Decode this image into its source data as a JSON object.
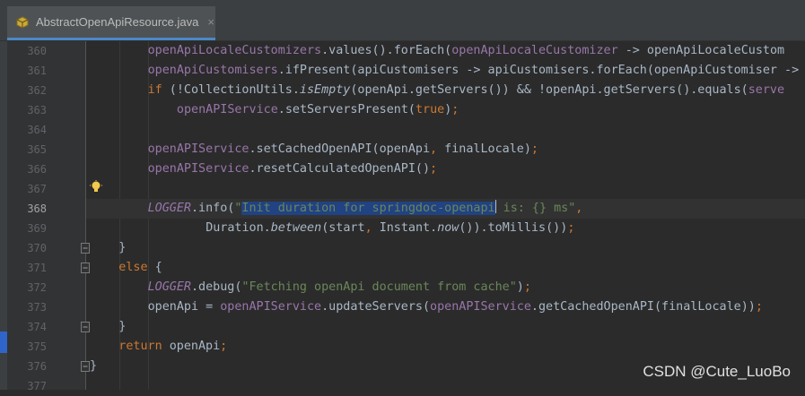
{
  "tab": {
    "filename": "AbstractOpenApiResource.java",
    "close_label": "×"
  },
  "watermark": "CSDN @Cute_LuoBo",
  "lines": [
    {
      "number": "360",
      "indent": 2,
      "current": false,
      "gutter_icon": null,
      "tokens": [
        {
          "text": "openApiLocaleCustomizers",
          "cls": "t-purple"
        },
        {
          "text": ".values().forEach(",
          "cls": ""
        },
        {
          "text": "openApiLocaleCustomizer",
          "cls": "t-purple"
        },
        {
          "text": " -> openApiLocaleCustom",
          "cls": ""
        }
      ]
    },
    {
      "number": "361",
      "indent": 2,
      "current": false,
      "gutter_icon": null,
      "tokens": [
        {
          "text": "openApiCustomisers",
          "cls": "t-purple"
        },
        {
          "text": ".ifPresent(apiCustomisers -> apiCustomisers.forEach(openApiCustomiser ->",
          "cls": ""
        }
      ]
    },
    {
      "number": "362",
      "indent": 2,
      "current": false,
      "gutter_icon": null,
      "tokens": [
        {
          "text": "if ",
          "cls": "t-orange"
        },
        {
          "text": "(!CollectionUtils.",
          "cls": ""
        },
        {
          "text": "isEmpty",
          "cls": "t-italic"
        },
        {
          "text": "(openApi.getServers()) && !openApi.getServers().equals(",
          "cls": ""
        },
        {
          "text": "serve",
          "cls": "t-purple"
        }
      ]
    },
    {
      "number": "363",
      "indent": 3,
      "current": false,
      "gutter_icon": null,
      "tokens": [
        {
          "text": "openAPIService",
          "cls": "t-purple"
        },
        {
          "text": ".setServersPresent(",
          "cls": ""
        },
        {
          "text": "true",
          "cls": "t-orange"
        },
        {
          "text": ")",
          "cls": ""
        },
        {
          "text": ";",
          "cls": "t-orange"
        }
      ]
    },
    {
      "number": "364",
      "indent": 0,
      "current": false,
      "gutter_icon": null,
      "tokens": []
    },
    {
      "number": "365",
      "indent": 2,
      "current": false,
      "gutter_icon": null,
      "tokens": [
        {
          "text": "openAPIService",
          "cls": "t-purple"
        },
        {
          "text": ".setCachedOpenAPI(openApi",
          "cls": ""
        },
        {
          "text": ", ",
          "cls": "t-orange"
        },
        {
          "text": "finalLocale)",
          "cls": ""
        },
        {
          "text": ";",
          "cls": "t-orange"
        }
      ]
    },
    {
      "number": "366",
      "indent": 2,
      "current": false,
      "gutter_icon": null,
      "tokens": [
        {
          "text": "openAPIService",
          "cls": "t-purple"
        },
        {
          "text": ".resetCalculatedOpenAPI()",
          "cls": ""
        },
        {
          "text": ";",
          "cls": "t-orange"
        }
      ]
    },
    {
      "number": "367",
      "indent": 0,
      "current": false,
      "gutter_icon": null,
      "tokens": []
    },
    {
      "number": "368",
      "indent": 2,
      "current": true,
      "gutter_icon": null,
      "tokens": [
        {
          "text": "LOGGER",
          "cls": "t-purple t-italic"
        },
        {
          "text": ".info(",
          "cls": ""
        },
        {
          "text": "\"",
          "cls": "t-green"
        },
        {
          "text": "Init duration for springdoc-openapi",
          "cls": "t-green sel"
        },
        {
          "text": "",
          "cls": "caret"
        },
        {
          "text": " is: {} ms\"",
          "cls": "t-green"
        },
        {
          "text": ",",
          "cls": "t-orange"
        }
      ]
    },
    {
      "number": "369",
      "indent": 4,
      "current": false,
      "gutter_icon": "bulb",
      "tokens": [
        {
          "text": "Duration.",
          "cls": ""
        },
        {
          "text": "between",
          "cls": "t-italic"
        },
        {
          "text": "(start",
          "cls": ""
        },
        {
          "text": ", ",
          "cls": "t-orange"
        },
        {
          "text": "Instant.",
          "cls": ""
        },
        {
          "text": "now",
          "cls": "t-italic"
        },
        {
          "text": "()).toMillis())",
          "cls": ""
        },
        {
          "text": ";",
          "cls": "t-orange"
        }
      ]
    },
    {
      "number": "370",
      "indent": 1,
      "current": false,
      "gutter_icon": "fold-end",
      "tokens": [
        {
          "text": "}",
          "cls": ""
        }
      ]
    },
    {
      "number": "371",
      "indent": 1,
      "current": false,
      "gutter_icon": "fold-start",
      "tokens": [
        {
          "text": "else ",
          "cls": "t-orange"
        },
        {
          "text": "{",
          "cls": ""
        }
      ]
    },
    {
      "number": "372",
      "indent": 2,
      "current": false,
      "gutter_icon": null,
      "tokens": [
        {
          "text": "LOGGER",
          "cls": "t-purple t-italic"
        },
        {
          "text": ".debug(",
          "cls": ""
        },
        {
          "text": "\"Fetching openApi document from cache\"",
          "cls": "t-green"
        },
        {
          "text": ")",
          "cls": ""
        },
        {
          "text": ";",
          "cls": "t-orange"
        }
      ]
    },
    {
      "number": "373",
      "indent": 2,
      "current": false,
      "gutter_icon": null,
      "tokens": [
        {
          "text": "openApi = ",
          "cls": ""
        },
        {
          "text": "openAPIService",
          "cls": "t-purple"
        },
        {
          "text": ".updateServers(",
          "cls": ""
        },
        {
          "text": "openAPIService",
          "cls": "t-purple"
        },
        {
          "text": ".getCachedOpenAPI(finalLocale))",
          "cls": ""
        },
        {
          "text": ";",
          "cls": "t-orange"
        }
      ]
    },
    {
      "number": "374",
      "indent": 1,
      "current": false,
      "gutter_icon": "fold-end",
      "tokens": [
        {
          "text": "}",
          "cls": ""
        }
      ]
    },
    {
      "number": "375",
      "indent": 1,
      "current": false,
      "gutter_icon": null,
      "tokens": [
        {
          "text": "return ",
          "cls": "t-orange"
        },
        {
          "text": "openApi",
          "cls": ""
        },
        {
          "text": ";",
          "cls": "t-orange"
        }
      ]
    },
    {
      "number": "376",
      "indent": 0,
      "current": false,
      "gutter_icon": "fold-end",
      "tokens": [
        {
          "text": "}",
          "cls": ""
        }
      ]
    },
    {
      "number": "377",
      "indent": 0,
      "current": false,
      "gutter_icon": null,
      "tokens": []
    }
  ]
}
